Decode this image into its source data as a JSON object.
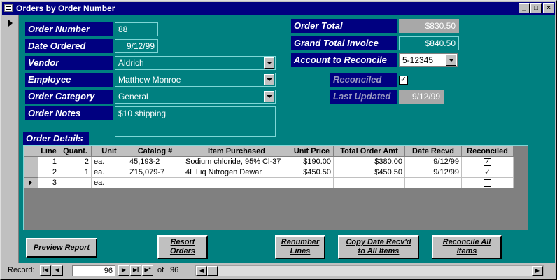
{
  "window": {
    "title": "Orders by Order Number",
    "minimize": "_",
    "maximize": "□",
    "close": "×"
  },
  "form": {
    "order_number_label": "Order Number",
    "order_number": "88",
    "date_ordered_label": "Date Ordered",
    "date_ordered": "9/12/99",
    "vendor_label": "Vendor",
    "vendor": "Aldrich",
    "employee_label": "Employee",
    "employee": "Matthew Monroe",
    "order_category_label": "Order Category",
    "order_category": "General",
    "order_notes_label": "Order Notes",
    "order_notes": "$10 shipping",
    "order_total_label": "Order Total",
    "order_total": "$830.50",
    "grand_total_label": "Grand Total Invoice",
    "grand_total": "$840.50",
    "account_label": "Account to Reconcile",
    "account": "5-12345",
    "reconciled_label": "Reconciled",
    "reconciled_mark": "✓",
    "last_updated_label": "Last Updated",
    "last_updated": "9/12/99",
    "details_label": "Order Details"
  },
  "details": {
    "columns": [
      "Line",
      "Quant.",
      "Unit",
      "Catalog #",
      "Item Purchased",
      "Unit Price",
      "Total Order Amt",
      "Date Recvd",
      "Reconciled"
    ],
    "rows": [
      {
        "line": "1",
        "quant": "2",
        "unit": "ea.",
        "catalog": "45,193-2",
        "item": "Sodium chloride, 95% Cl-37",
        "price": "$190.00",
        "total": "$380.00",
        "date": "9/12/99",
        "reconciled": "✓"
      },
      {
        "line": "2",
        "quant": "1",
        "unit": "ea.",
        "catalog": "Z15,079-7",
        "item": "4L Liq Nitrogen Dewar",
        "price": "$450.50",
        "total": "$450.50",
        "date": "9/12/99",
        "reconciled": "✓"
      },
      {
        "line": "3",
        "quant": "",
        "unit": "ea.",
        "catalog": "",
        "item": "",
        "price": "",
        "total": "",
        "date": "",
        "reconciled": ""
      }
    ]
  },
  "buttons": {
    "preview": "Preview Report",
    "resort": "Resort Orders",
    "renumber": "Renumber Lines",
    "copy_date": "Copy Date Recv'd to All Items",
    "reconcile_all": "Reconcile All Items"
  },
  "nav": {
    "record_label": "Record:",
    "first": "I◀",
    "prev": "◀",
    "current": "96",
    "next": "▶",
    "last": "▶I",
    "new": "▶*",
    "of_label": "of",
    "total": "96",
    "scroll_left": "◀",
    "scroll_right": "▶"
  }
}
